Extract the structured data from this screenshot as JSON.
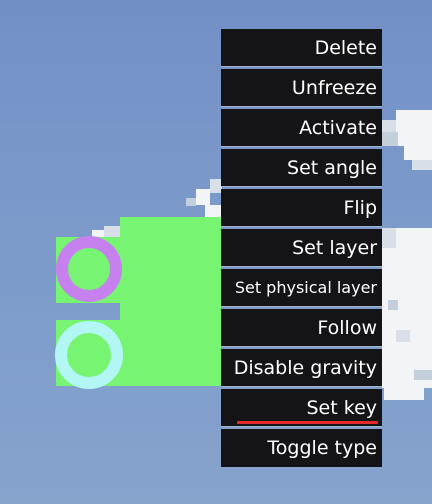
{
  "menu": {
    "items": [
      {
        "label": "Delete"
      },
      {
        "label": "Unfreeze"
      },
      {
        "label": "Activate"
      },
      {
        "label": "Set angle"
      },
      {
        "label": "Flip"
      },
      {
        "label": "Set layer"
      },
      {
        "label": "Set physical layer"
      },
      {
        "label": "Follow"
      },
      {
        "label": "Disable gravity"
      },
      {
        "label": "Set key"
      },
      {
        "label": "Toggle type"
      }
    ],
    "highlighted_item": "Set key",
    "highlight_color": "#e22a2a"
  },
  "scene": {
    "sky_color": "#7b98c8",
    "body_color": "#77f471",
    "ring_colors": {
      "top": "#c681ee",
      "bottom": "#b3f7f4"
    }
  }
}
